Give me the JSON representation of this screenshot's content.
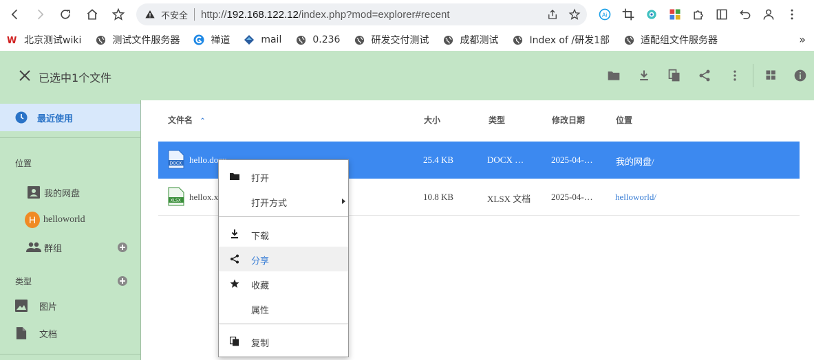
{
  "browser": {
    "insecure_label": "不安全",
    "url_prefix": "http://",
    "url_host": "192.168.122.12",
    "url_path": "/index.php?mod=explorer#recent"
  },
  "bookmarks": [
    {
      "label": "北京测试wiki",
      "icon": "red-logo-icon"
    },
    {
      "label": "测试文件服务器",
      "icon": "globe-icon"
    },
    {
      "label": "禅道",
      "icon": "zentao-icon"
    },
    {
      "label": "mail",
      "icon": "mail-icon"
    },
    {
      "label": "0.236",
      "icon": "globe-icon"
    },
    {
      "label": "研发交付测试",
      "icon": "globe-icon"
    },
    {
      "label": "成都测试",
      "icon": "globe-icon"
    },
    {
      "label": "Index of /研发1部",
      "icon": "globe-icon"
    },
    {
      "label": "适配组文件服务器",
      "icon": "globe-icon"
    }
  ],
  "bookmarks_more": "»",
  "header": {
    "selection_title": "已选中1个文件"
  },
  "sidebar": {
    "recent": "最近使用",
    "location_section": "位置",
    "my_drive": "我的网盘",
    "helloworld": "helloworld",
    "avatar_letter": "H",
    "groups": "群组",
    "type_section": "类型",
    "images": "图片",
    "documents": "文档"
  },
  "table": {
    "headers": {
      "name": "文件名",
      "size": "大小",
      "type": "类型",
      "modified": "修改日期",
      "location": "位置"
    },
    "rows": [
      {
        "name": "hello.docx",
        "size": "25.4 KB",
        "type": "DOCX …",
        "modified": "2025-04-…",
        "location": "我的网盘/"
      },
      {
        "name": "hellox.xlsx",
        "size": "10.8 KB",
        "type": "XLSX 文档",
        "modified": "2025-04-…",
        "location": "helloworld/"
      }
    ]
  },
  "context_menu": {
    "open": "打开",
    "open_with": "打开方式",
    "download": "下载",
    "share": "分享",
    "favorite": "收藏",
    "properties": "属性",
    "copy": "复制"
  },
  "colors": {
    "header_bg": "#c3e5c6",
    "selected_row": "#3c89f0",
    "accent_blue": "#2a73c7"
  }
}
